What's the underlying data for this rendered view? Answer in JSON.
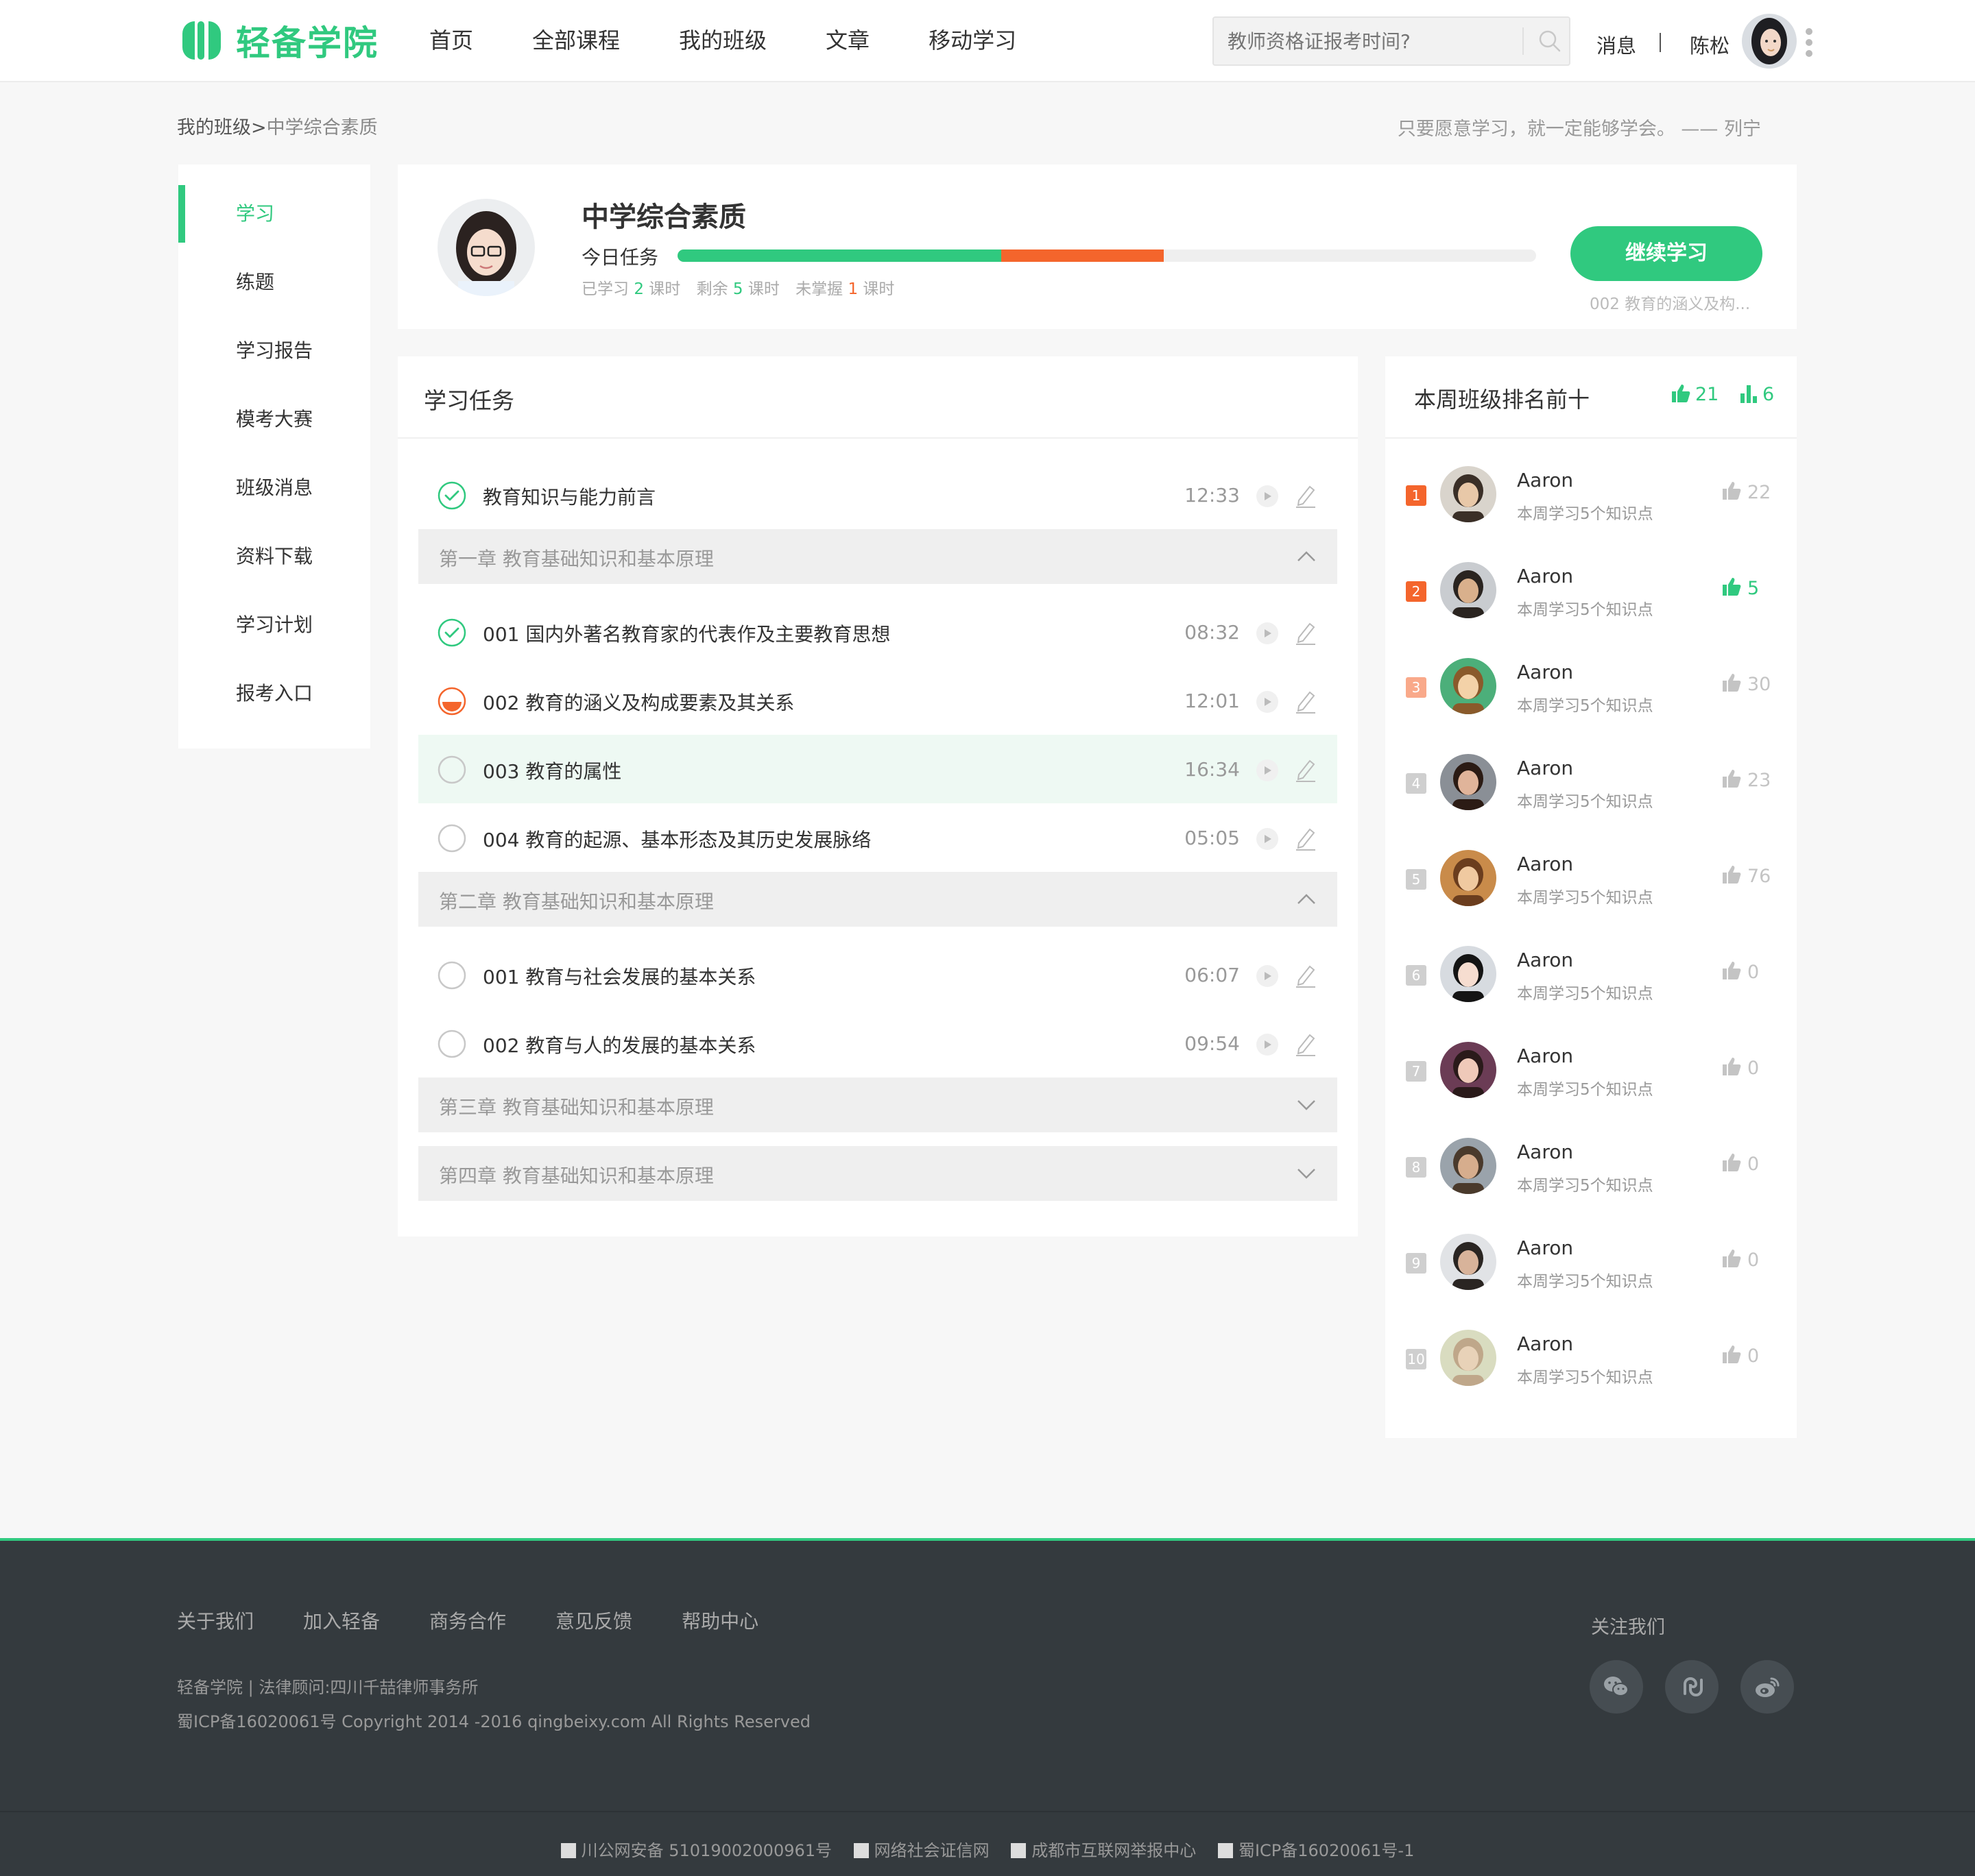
{
  "brand": {
    "name": "轻备学院",
    "color": "#30c97f"
  },
  "nav": [
    "首页",
    "全部课程",
    "我的班级",
    "文章",
    "移动学习"
  ],
  "search": {
    "placeholder": "教师资格证报考时间?"
  },
  "user": {
    "messages": "消息",
    "name": "陈松"
  },
  "breadcrumb": {
    "parent": "我的班级",
    "sep": ">",
    "current": "中学综合素质"
  },
  "quote": "只要愿意学习，就一定能够学会。 —— 列宁",
  "menu": [
    "学习",
    "练题",
    "学习报告",
    "模考大赛",
    "班级消息",
    "资料下载",
    "学习计划",
    "报考入口"
  ],
  "course": {
    "title": "中学综合素质",
    "today_label": "今日任务",
    "progress": {
      "learned_fraction": 0.377,
      "weak_fraction": 0.189
    },
    "stats": {
      "learned_pre": "已学习",
      "learned": "2",
      "remain_pre": "剩余",
      "remain": "5",
      "weak_pre": "未掌握",
      "weak": "1",
      "unit": "课时"
    },
    "continue_label": "继续学习",
    "continue_sub": "002 教育的涵义及构..."
  },
  "tasks": {
    "title": "学习任务",
    "intro": {
      "label": "教育知识与能力前言",
      "time": "12:33",
      "status": "done"
    },
    "chapters": [
      {
        "title": "第一章 教育基础知识和基本原理",
        "expanded": true,
        "items": [
          {
            "label": "001 国内外著名教育家的代表作及主要教育思想",
            "time": "08:32",
            "status": "done"
          },
          {
            "label": "002 教育的涵义及构成要素及其关系",
            "time": "12:01",
            "status": "half"
          },
          {
            "label": "003 教育的属性",
            "time": "16:34",
            "status": "todo",
            "highlight": true
          },
          {
            "label": "004 教育的起源、基本形态及其历史发展脉络",
            "time": "05:05",
            "status": "todo"
          }
        ]
      },
      {
        "title": "第二章 教育基础知识和基本原理",
        "expanded": true,
        "items": [
          {
            "label": "001 教育与社会发展的基本关系",
            "time": "06:07",
            "status": "todo"
          },
          {
            "label": "002 教育与人的发展的基本关系",
            "time": "09:54",
            "status": "todo"
          }
        ]
      },
      {
        "title": "第三章 教育基础知识和基本原理",
        "expanded": false,
        "items": []
      },
      {
        "title": "第四章 教育基础知识和基本原理",
        "expanded": false,
        "items": []
      }
    ]
  },
  "ranking": {
    "title": "本周班级排名前十",
    "likes": "21",
    "bars": "6",
    "rows": [
      {
        "num": "1",
        "name": "Aaron",
        "desc": "本周学习5个知识点",
        "likes": "22",
        "liked": false
      },
      {
        "num": "2",
        "name": "Aaron",
        "desc": "本周学习5个知识点",
        "likes": "5",
        "liked": true
      },
      {
        "num": "3",
        "name": "Aaron",
        "desc": "本周学习5个知识点",
        "likes": "30",
        "liked": false
      },
      {
        "num": "4",
        "name": "Aaron",
        "desc": "本周学习5个知识点",
        "likes": "23",
        "liked": false
      },
      {
        "num": "5",
        "name": "Aaron",
        "desc": "本周学习5个知识点",
        "likes": "76",
        "liked": false
      },
      {
        "num": "6",
        "name": "Aaron",
        "desc": "本周学习5个知识点",
        "likes": "0",
        "liked": false
      },
      {
        "num": "7",
        "name": "Aaron",
        "desc": "本周学习5个知识点",
        "likes": "0",
        "liked": false
      },
      {
        "num": "8",
        "name": "Aaron",
        "desc": "本周学习5个知识点",
        "likes": "0",
        "liked": false
      },
      {
        "num": "9",
        "name": "Aaron",
        "desc": "本周学习5个知识点",
        "likes": "0",
        "liked": false
      },
      {
        "num": "10",
        "name": "Aaron",
        "desc": "本周学习5个知识点",
        "likes": "0",
        "liked": false
      }
    ]
  },
  "footer": {
    "links": [
      "关于我们",
      "加入轻备",
      "商务合作",
      "意见反馈",
      "帮助中心"
    ],
    "line1": "轻备学院 | 法律顾问:四川千喆律师事务所",
    "line2": "蜀ICP备16020061号 Copyright 2014 -2016 qingbeixy.com All Rights Reserved",
    "follow": "关注我们",
    "social": [
      "wechat-icon",
      "link-icon",
      "weibo-icon"
    ],
    "bottom": [
      "川公网安备 51019002000961号",
      "网络社会证信网",
      "成都市互联网举报中心",
      "蜀ICP备16020061号-1"
    ]
  },
  "colors": {
    "accent": "#30c97f",
    "warning": "#f4652c",
    "footer_bg": "#343a3e"
  }
}
